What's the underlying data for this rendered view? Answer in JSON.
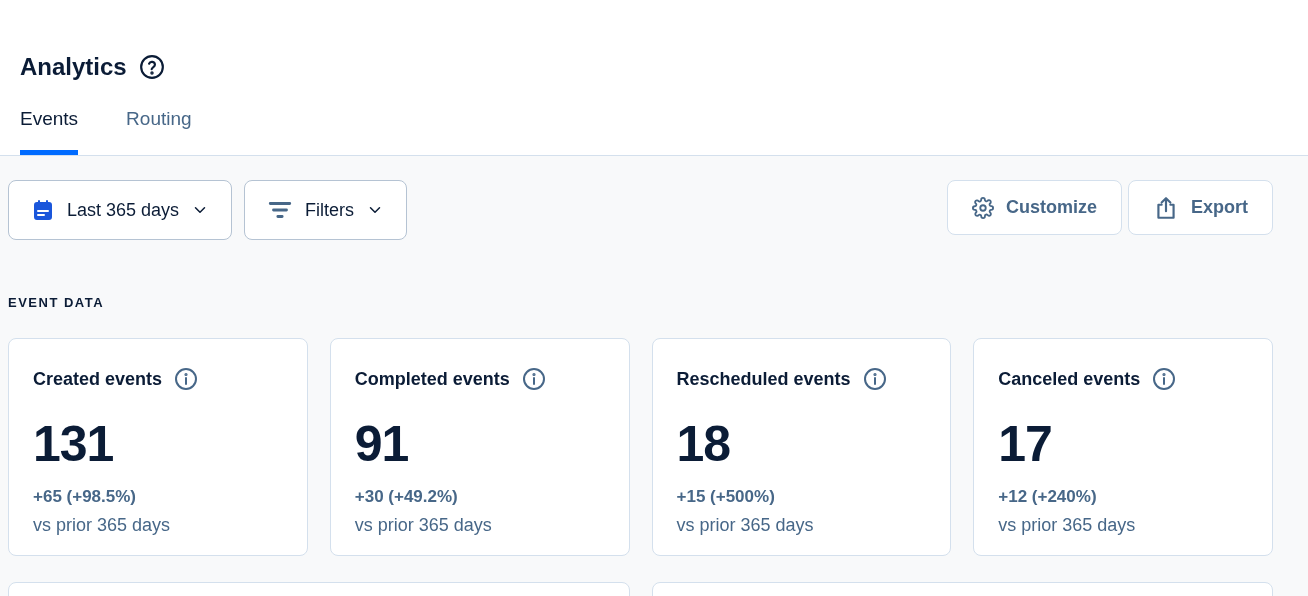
{
  "header": {
    "title": "Analytics"
  },
  "tabs": [
    {
      "label": "Events",
      "selected": true
    },
    {
      "label": "Routing",
      "selected": false
    }
  ],
  "toolbar": {
    "left": [
      {
        "kind": "date",
        "label": "Last 365 days"
      },
      {
        "kind": "filter",
        "label": "Filters"
      }
    ],
    "right": [
      {
        "kind": "customize",
        "label": "Customize"
      },
      {
        "kind": "export",
        "label": "Export"
      }
    ]
  },
  "section": {
    "label": "EVENT DATA"
  },
  "cards": [
    {
      "title": "Created events",
      "value": "131",
      "change": "+65 (+98.5%)",
      "comparison": "vs prior 365 days"
    },
    {
      "title": "Completed events",
      "value": "91",
      "change": "+30 (+49.2%)",
      "comparison": "vs prior 365 days"
    },
    {
      "title": "Rescheduled events",
      "value": "18",
      "change": "+15 (+500%)",
      "comparison": "vs prior 365 days"
    },
    {
      "title": "Canceled events",
      "value": "17",
      "change": "+12 (+240%)",
      "comparison": "vs prior 365 days"
    }
  ]
}
